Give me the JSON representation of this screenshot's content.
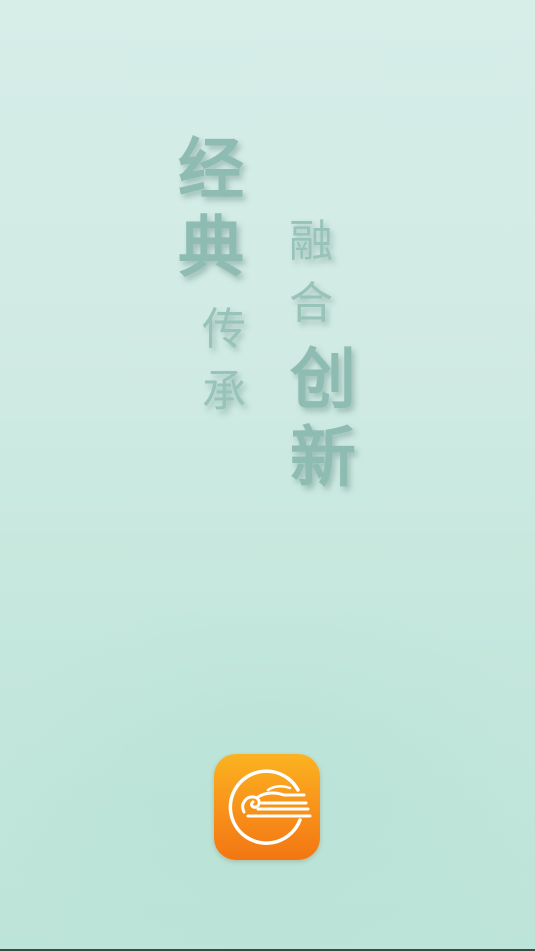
{
  "splash": {
    "slogan_left_big": [
      "经",
      "典"
    ],
    "slogan_left_small": [
      "传",
      "承"
    ],
    "slogan_right_small": [
      "融",
      "合"
    ],
    "slogan_right_big": [
      "创",
      "新"
    ]
  },
  "app_icon": {
    "icon": "cloud-pattern-logo-icon",
    "color_top": "#fbb320",
    "color_bottom": "#f27612"
  },
  "colors": {
    "text": "#8fbcb2",
    "background_top": "#d6ede8",
    "background_bottom": "#bde4d9"
  }
}
